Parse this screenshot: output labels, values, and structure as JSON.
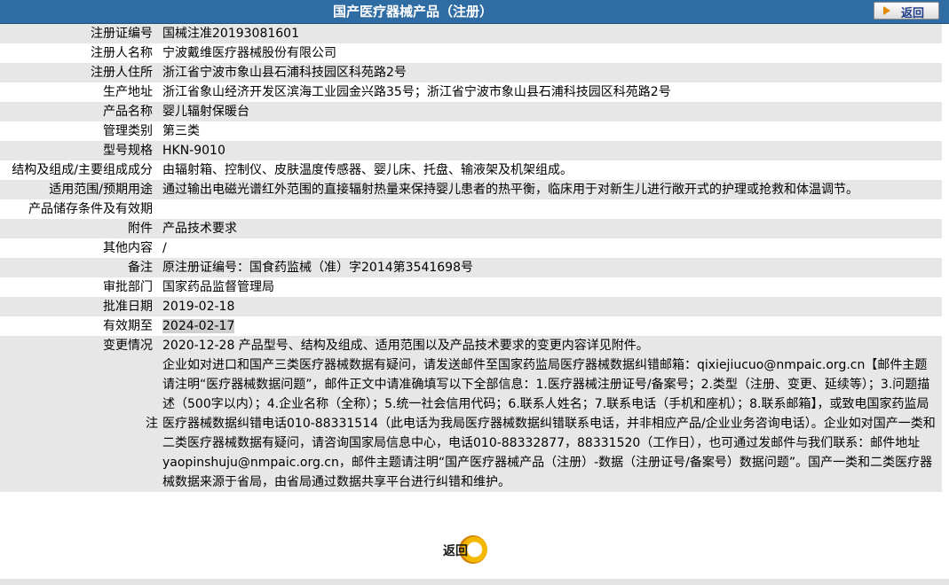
{
  "header": {
    "title": "国产医疗器械产品（注册）",
    "back_label": "返回"
  },
  "fields": [
    {
      "label": "注册证编号",
      "value": "国械注准20193081601"
    },
    {
      "label": "注册人名称",
      "value": "宁波戴维医疗器械股份有限公司"
    },
    {
      "label": "注册人住所",
      "value": "浙江省宁波市象山县石浦科技园区科苑路2号"
    },
    {
      "label": "生产地址",
      "value": "浙江省象山经济开发区滨海工业园金兴路35号；浙江省宁波市象山县石浦科技园区科苑路2号"
    },
    {
      "label": "产品名称",
      "value": "婴儿辐射保暖台"
    },
    {
      "label": "管理类别",
      "value": "第三类"
    },
    {
      "label": "型号规格",
      "value": "HKN-9010"
    },
    {
      "label": "结构及组成/主要组成成分",
      "value": "由辐射箱、控制仪、皮肤温度传感器、婴儿床、托盘、输液架及机架组成。"
    },
    {
      "label": "适用范围/预期用途",
      "value": "通过输出电磁光谱红外范围的直接辐射热量来保持婴儿患者的热平衡，临床用于对新生儿进行敞开式的护理或抢救和体温调节。"
    },
    {
      "label": "产品储存条件及有效期",
      "value": ""
    },
    {
      "label": "附件",
      "value": "产品技术要求"
    },
    {
      "label": "其他内容",
      "value": "/"
    },
    {
      "label": "备注",
      "value": "原注册证编号：国食药监械（准）字2014第3541698号"
    },
    {
      "label": "审批部门",
      "value": "国家药品监督管理局"
    },
    {
      "label": "批准日期",
      "value": "2019-02-18"
    },
    {
      "label": "有效期至",
      "value": "2024-02-17"
    },
    {
      "label": "变更情况",
      "value": "2020-12-28 产品型号、结构及组成、适用范围以及产品技术要求的变更内容详见附件。"
    }
  ],
  "note": {
    "label": "注",
    "text": "企业如对进口和国产三类医疗器械数据有疑问，请发送邮件至国家药监局医疗器械数据纠错邮箱：qixiejiucuo@nmpaic.org.cn【邮件主题请注明“医疗器械数据问题”，邮件正文中请准确填写以下全部信息：1.医疗器械注册证号/备案号；2.类型（注册、变更、延续等）；3.问题描述（500字以内）；4.企业名称（全称）；5.统一社会信用代码；6.联系人姓名；7.联系电话（手机和座机）；8.联系邮箱】，或致电国家药监局医疗器械数据纠错电话010-88331514（此电话为我局医疗器械数据纠错联系电话，并非相应产品/企业业务咨询电话）。企业如对国产一类和二类医疗器械数据有疑问，请咨询国家局信息中心，电话010-88332877，88331520（工作日），也可通过发邮件与我们联系：邮件地址yaopinshuju@nmpaic.org.cn，邮件主题请注明“国产医疗器械产品（注册）-数据（注册证号/备案号）数据问题”。国产一类和二类医疗器械数据来源于省局，由省局通过数据共享平台进行纠错和维护。"
  },
  "footer": {
    "back_label": "返回"
  }
}
